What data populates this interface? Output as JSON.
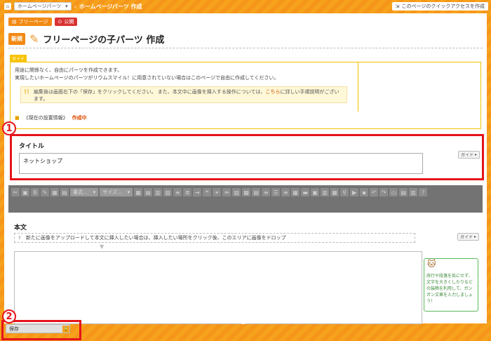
{
  "topbar": {
    "home_icon": "home-icon",
    "breadcrumb_select": "ホームページパーツ",
    "breadcrumb_current": "ホームページパーツ 作成",
    "quick_access": "このページのクイックアクセスを作成"
  },
  "tabs": {
    "free": "フリーページ",
    "public": "公開"
  },
  "header": {
    "badge": "新規",
    "title": "フリーページの子パーツ 作成"
  },
  "guide": {
    "tag": "ガイド",
    "line1": "用途に関係なく、自由にパーツを作成できます。",
    "line2": "実現したいホームページのパーツがリウムスマイル！に用意されていない場合はこのページで自由に作成してください。",
    "note_pre": "編集後は画面右下の「保存」をクリックしてください。 また、本文中に画像を挿入する操作については、",
    "note_link": "こちら",
    "note_post": "に詳しい手順説明がございます。",
    "status_label": "《現在の設置情報》",
    "status_value": "作成中"
  },
  "title_section": {
    "label": "タイトル",
    "value": "ネットショップ",
    "guide_button": "ガイド"
  },
  "toolbar": {
    "format_select": "書式...",
    "size_select": "サイズ..."
  },
  "body_section": {
    "label": "本文",
    "drop_hint": "新たに画像をアップロードして本文に挿入したい場合は、挿入したい場所をクリック後、このエリアに画像をドロップ",
    "guide_button": "ガイド",
    "mascot_tip": "改行や段落を気にせず、文字を大きくしたりなどの装飾を利用して、ガンガン文章を入力しましょう！"
  },
  "footer": {
    "save_label": "保存"
  },
  "callouts": {
    "one": "1",
    "two": "2"
  },
  "colors": {
    "accent": "#f7a21c",
    "highlight": "#e5141a"
  }
}
